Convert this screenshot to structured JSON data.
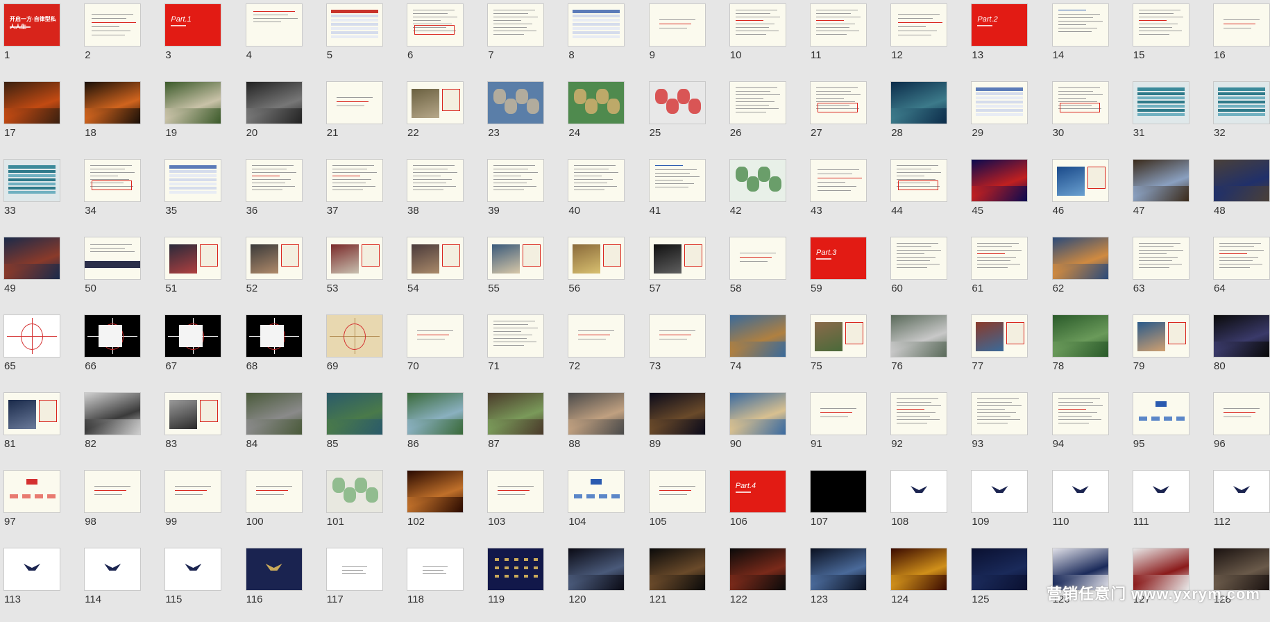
{
  "view": "slide-sorter",
  "slides": [
    {
      "n": "1",
      "t": "red-title",
      "caption": "开启一方·自律型私人人生"
    },
    {
      "n": "2",
      "t": "text-list"
    },
    {
      "n": "3",
      "t": "red-part",
      "caption": "Part.1"
    },
    {
      "n": "4",
      "t": "text-short"
    },
    {
      "n": "5",
      "t": "table"
    },
    {
      "n": "6",
      "t": "text-box"
    },
    {
      "n": "7",
      "t": "text"
    },
    {
      "n": "8",
      "t": "table-blue"
    },
    {
      "n": "9",
      "t": "text-center"
    },
    {
      "n": "10",
      "t": "text-red"
    },
    {
      "n": "11",
      "t": "text-red"
    },
    {
      "n": "12",
      "t": "text-list"
    },
    {
      "n": "13",
      "t": "red-part",
      "caption": "Part.2"
    },
    {
      "n": "14",
      "t": "text-blue"
    },
    {
      "n": "15",
      "t": "text-red"
    },
    {
      "n": "16",
      "t": "text-center"
    },
    {
      "n": "17",
      "t": "photo",
      "c1": "#3a2010",
      "c2": "#c24a12"
    },
    {
      "n": "18",
      "t": "photo",
      "c1": "#1a1008",
      "c2": "#d0641e"
    },
    {
      "n": "19",
      "t": "photo",
      "c1": "#3b5a2a",
      "c2": "#c9c2a8"
    },
    {
      "n": "20",
      "t": "photo",
      "c1": "#222",
      "c2": "#777"
    },
    {
      "n": "21",
      "t": "text-center"
    },
    {
      "n": "22",
      "t": "photo-text",
      "c1": "#6a6040",
      "c2": "#b7a88a"
    },
    {
      "n": "23",
      "t": "map",
      "c1": "#5a7ea8",
      "c2": "#c8b89a"
    },
    {
      "n": "24",
      "t": "map",
      "c1": "#4f8a4e",
      "c2": "#d8b070"
    },
    {
      "n": "25",
      "t": "map",
      "c1": "#e8e8e8",
      "c2": "#d43030"
    },
    {
      "n": "26",
      "t": "text"
    },
    {
      "n": "27",
      "t": "text-box"
    },
    {
      "n": "28",
      "t": "photo",
      "c1": "#0c2c4a",
      "c2": "#3c7a8a"
    },
    {
      "n": "29",
      "t": "table-blue"
    },
    {
      "n": "30",
      "t": "text-box"
    },
    {
      "n": "31",
      "t": "table-teal"
    },
    {
      "n": "32",
      "t": "table-teal"
    },
    {
      "n": "33",
      "t": "table-teal"
    },
    {
      "n": "34",
      "t": "text-box"
    },
    {
      "n": "35",
      "t": "table-blue"
    },
    {
      "n": "36",
      "t": "text-red"
    },
    {
      "n": "37",
      "t": "text-red"
    },
    {
      "n": "38",
      "t": "text"
    },
    {
      "n": "39",
      "t": "text"
    },
    {
      "n": "40",
      "t": "text"
    },
    {
      "n": "41",
      "t": "text-blue"
    },
    {
      "n": "42",
      "t": "map",
      "c1": "#e8f0e8",
      "c2": "#4a8a4a"
    },
    {
      "n": "43",
      "t": "text-list"
    },
    {
      "n": "44",
      "t": "text-box"
    },
    {
      "n": "45",
      "t": "photo",
      "c1": "#0a0a50",
      "c2": "#c02020"
    },
    {
      "n": "46",
      "t": "photo-text",
      "c1": "#1a4a8a",
      "c2": "#6aa0d0"
    },
    {
      "n": "47",
      "t": "photo",
      "c1": "#3a2a1a",
      "c2": "#8aa0c0"
    },
    {
      "n": "48",
      "t": "photo",
      "c1": "#4a4038",
      "c2": "#20306a"
    },
    {
      "n": "49",
      "t": "photo",
      "c1": "#1a2a4a",
      "c2": "#8a3a2a"
    },
    {
      "n": "50",
      "t": "text-bar"
    },
    {
      "n": "51",
      "t": "photo-text",
      "c1": "#2a2a3a",
      "c2": "#b04040"
    },
    {
      "n": "52",
      "t": "photo-text",
      "c1": "#3a3a3a",
      "c2": "#b08a6a"
    },
    {
      "n": "53",
      "t": "photo-text",
      "c1": "#7a2a2a",
      "c2": "#c8c0b0"
    },
    {
      "n": "54",
      "t": "photo-text",
      "c1": "#4a3a3a",
      "c2": "#aa8a6a"
    },
    {
      "n": "55",
      "t": "photo-text",
      "c1": "#3a5a7a",
      "c2": "#d8c8a8"
    },
    {
      "n": "56",
      "t": "photo-text",
      "c1": "#8a6a3a",
      "c2": "#d8c070"
    },
    {
      "n": "57",
      "t": "photo-text",
      "c1": "#101010",
      "c2": "#606060"
    },
    {
      "n": "58",
      "t": "text-center"
    },
    {
      "n": "59",
      "t": "red-part",
      "caption": "Part.3"
    },
    {
      "n": "60",
      "t": "text"
    },
    {
      "n": "61",
      "t": "text-red"
    },
    {
      "n": "62",
      "t": "photo",
      "c1": "#2a4a7a",
      "c2": "#d08a40"
    },
    {
      "n": "63",
      "t": "text"
    },
    {
      "n": "64",
      "t": "text-red"
    },
    {
      "n": "65",
      "t": "plan",
      "c1": "#ffffff",
      "c2": "#d43030"
    },
    {
      "n": "66",
      "t": "plan-dark",
      "c1": "#000000",
      "c2": "#ffffff"
    },
    {
      "n": "67",
      "t": "plan-dark",
      "c1": "#000000",
      "c2": "#ffffff"
    },
    {
      "n": "68",
      "t": "plan-dark",
      "c1": "#000000",
      "c2": "#ffffff"
    },
    {
      "n": "69",
      "t": "plan",
      "c1": "#e8d8b0",
      "c2": "#b08a50"
    },
    {
      "n": "70",
      "t": "text-center"
    },
    {
      "n": "71",
      "t": "text"
    },
    {
      "n": "72",
      "t": "text-center"
    },
    {
      "n": "73",
      "t": "text-center"
    },
    {
      "n": "74",
      "t": "photo",
      "c1": "#3a6a9a",
      "c2": "#b08040"
    },
    {
      "n": "75",
      "t": "photo-text",
      "c1": "#8a6a4a",
      "c2": "#4a6a3a"
    },
    {
      "n": "76",
      "t": "photo",
      "c1": "#5a6a5a",
      "c2": "#c8c8c8"
    },
    {
      "n": "77",
      "t": "photo-text",
      "c1": "#8a3a2a",
      "c2": "#3a6a9a"
    },
    {
      "n": "78",
      "t": "photo",
      "c1": "#2a5a2a",
      "c2": "#6a9a5a"
    },
    {
      "n": "79",
      "t": "photo-text",
      "c1": "#2a5a8a",
      "c2": "#d0a070"
    },
    {
      "n": "80",
      "t": "photo",
      "c1": "#0a0a0a",
      "c2": "#3a3a6a"
    },
    {
      "n": "81",
      "t": "photo-text",
      "c1": "#1a2a4a",
      "c2": "#6a7a9a"
    },
    {
      "n": "82",
      "t": "photo",
      "c1": "#d0d0d0",
      "c2": "#3a3a3a"
    },
    {
      "n": "83",
      "t": "photo-text",
      "c1": "#9a9a9a",
      "c2": "#2a2a2a"
    },
    {
      "n": "84",
      "t": "photo",
      "c1": "#4a5a3a",
      "c2": "#8a8a8a"
    },
    {
      "n": "85",
      "t": "photo",
      "c1": "#2a5a6a",
      "c2": "#4a7a4a"
    },
    {
      "n": "86",
      "t": "photo",
      "c1": "#3a6a3a",
      "c2": "#8ab0c0"
    },
    {
      "n": "87",
      "t": "photo",
      "c1": "#4a3a2a",
      "c2": "#7a9a5a"
    },
    {
      "n": "88",
      "t": "photo",
      "c1": "#4a4a4a",
      "c2": "#c0a080"
    },
    {
      "n": "89",
      "t": "photo",
      "c1": "#0a0a1a",
      "c2": "#6a4a2a"
    },
    {
      "n": "90",
      "t": "photo",
      "c1": "#3a6aa0",
      "c2": "#d8c090"
    },
    {
      "n": "91",
      "t": "text-center"
    },
    {
      "n": "92",
      "t": "text-red"
    },
    {
      "n": "93",
      "t": "text"
    },
    {
      "n": "94",
      "t": "text-red"
    },
    {
      "n": "95",
      "t": "diagram"
    },
    {
      "n": "96",
      "t": "text-center"
    },
    {
      "n": "97",
      "t": "diagram-red"
    },
    {
      "n": "98",
      "t": "text-center"
    },
    {
      "n": "99",
      "t": "text-center"
    },
    {
      "n": "100",
      "t": "text-center"
    },
    {
      "n": "101",
      "t": "map",
      "c1": "#e8e8e0",
      "c2": "#7ab07a"
    },
    {
      "n": "102",
      "t": "photo",
      "c1": "#2a0a00",
      "c2": "#c0702a"
    },
    {
      "n": "103",
      "t": "text-center"
    },
    {
      "n": "104",
      "t": "diagram"
    },
    {
      "n": "105",
      "t": "text-center"
    },
    {
      "n": "106",
      "t": "red-part",
      "caption": "Part.4"
    },
    {
      "n": "107",
      "t": "black"
    },
    {
      "n": "108",
      "t": "logo-white"
    },
    {
      "n": "109",
      "t": "logo-white"
    },
    {
      "n": "110",
      "t": "logo-white"
    },
    {
      "n": "111",
      "t": "logo-white"
    },
    {
      "n": "112",
      "t": "logo-white"
    },
    {
      "n": "113",
      "t": "logo-white"
    },
    {
      "n": "114",
      "t": "logo-white"
    },
    {
      "n": "115",
      "t": "logo-white"
    },
    {
      "n": "116",
      "t": "logo-navy"
    },
    {
      "n": "117",
      "t": "white-faint"
    },
    {
      "n": "118",
      "t": "white-faint"
    },
    {
      "n": "119",
      "t": "navy-grid"
    },
    {
      "n": "120",
      "t": "photo",
      "c1": "#0a0a14",
      "c2": "#4a5a7a"
    },
    {
      "n": "121",
      "t": "photo",
      "c1": "#0a0a0a",
      "c2": "#6a4a2a"
    },
    {
      "n": "122",
      "t": "photo",
      "c1": "#0a0a0a",
      "c2": "#7a2a1a"
    },
    {
      "n": "123",
      "t": "photo",
      "c1": "#0a1020",
      "c2": "#4a6a9a"
    },
    {
      "n": "124",
      "t": "photo",
      "c1": "#3a0a00",
      "c2": "#d0901a"
    },
    {
      "n": "125",
      "t": "photo",
      "c1": "#0a1030",
      "c2": "#1a2a5a"
    },
    {
      "n": "126",
      "t": "photo",
      "c1": "#e0e0e8",
      "c2": "#1a2a5a"
    },
    {
      "n": "127",
      "t": "photo",
      "c1": "#e8e8e8",
      "c2": "#8a1a1a"
    },
    {
      "n": "128",
      "t": "photo",
      "c1": "#1a1210",
      "c2": "#6a5a4a"
    }
  ],
  "watermark": "营销任意门 www.yxrym.com"
}
